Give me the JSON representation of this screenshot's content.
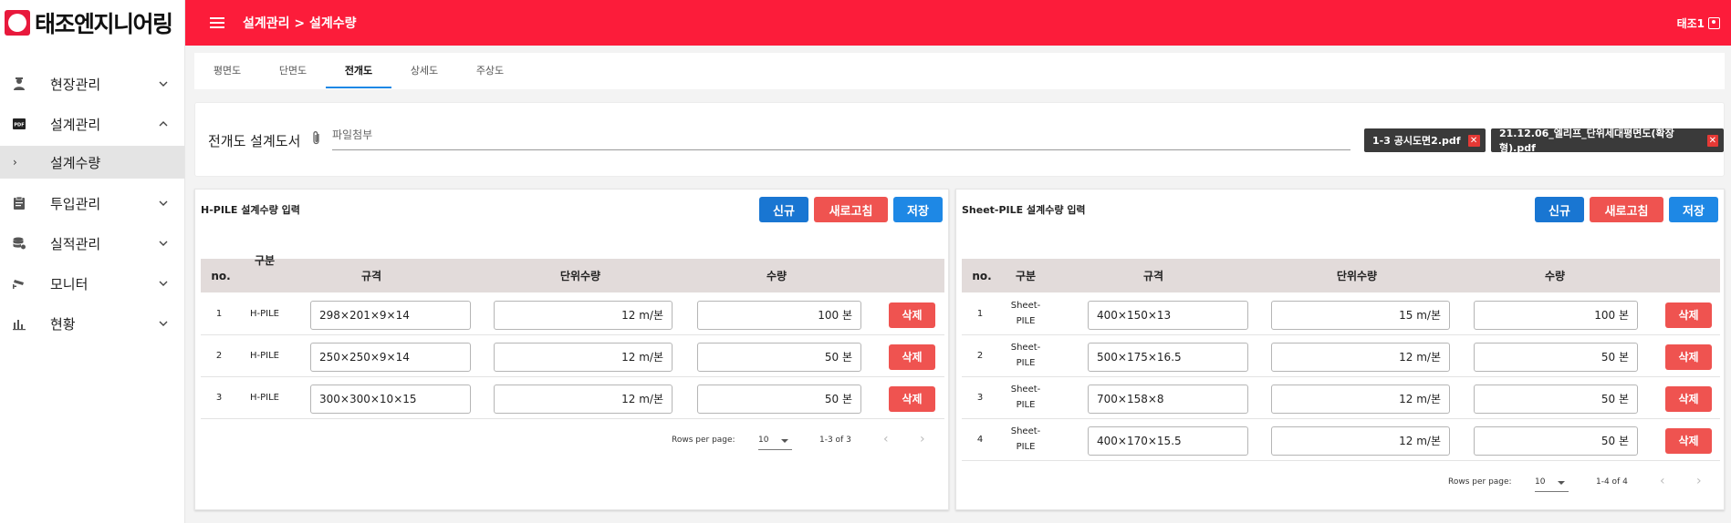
{
  "sidebar": {
    "logo_text": "태조엔지니어링",
    "items": [
      {
        "label": "현장관리",
        "icon": "worker-icon"
      },
      {
        "label": "설계관리",
        "icon": "pdf-icon"
      },
      {
        "label": "설계수량",
        "icon": "chevron-right-icon"
      },
      {
        "label": "투입관리",
        "icon": "clipboard-icon"
      },
      {
        "label": "실적관리",
        "icon": "database-icon"
      },
      {
        "label": "모니터",
        "icon": "cctv-icon"
      },
      {
        "label": "현황",
        "icon": "bar-chart-icon"
      }
    ]
  },
  "topbar": {
    "breadcrumb": "설계관리 > 설계수량",
    "user": "태조1",
    "accent": "#fc1c3a"
  },
  "tabs": [
    "평면도",
    "단면도",
    "전개도",
    "상세도",
    "주상도"
  ],
  "active_tab": "전개도",
  "files": {
    "title": "전개도 설계도서",
    "placeholder": "파일첨부",
    "chips": [
      "1-3 공시도면2.pdf",
      "21.12.06_엘리프_단위세대평면도(확장형).pdf"
    ]
  },
  "hpile": {
    "title": "H-PILE 설계수량 입력",
    "buttons": {
      "new": "신규",
      "refresh": "새로고침",
      "save": "저장"
    },
    "columns": [
      "no.",
      "구분",
      "규격",
      "단위수량",
      "수량"
    ],
    "rows": [
      {
        "no": "1",
        "type": "H-PILE",
        "spec": "298×201×9×14",
        "unit": "12 m/본",
        "qty": "100 본",
        "del": "삭제"
      },
      {
        "no": "2",
        "type": "H-PILE",
        "spec": "250×250×9×14",
        "unit": "12 m/본",
        "qty": "50 본",
        "del": "삭제"
      },
      {
        "no": "3",
        "type": "H-PILE",
        "spec": "300×300×10×15",
        "unit": "12 m/본",
        "qty": "50 본",
        "del": "삭제"
      }
    ],
    "pager": {
      "label": "Rows per page:",
      "per_page": "10",
      "range": "1-3 of 3"
    }
  },
  "sheetpile": {
    "title": "Sheet-PILE 설계수량 입력",
    "buttons": {
      "new": "신규",
      "refresh": "새로고침",
      "save": "저장"
    },
    "columns": [
      "no.",
      "구분",
      "규격",
      "단위수량",
      "수량"
    ],
    "rows": [
      {
        "no": "1",
        "type1": "Sheet-",
        "type2": "PILE",
        "spec": "400×150×13",
        "unit": "15 m/본",
        "qty": "100 본",
        "del": "삭제"
      },
      {
        "no": "2",
        "type1": "Sheet-",
        "type2": "PILE",
        "spec": "500×175×16.5",
        "unit": "12 m/본",
        "qty": "50 본",
        "del": "삭제"
      },
      {
        "no": "3",
        "type1": "Sheet-",
        "type2": "PILE",
        "spec": "700×158×8",
        "unit": "12 m/본",
        "qty": "50 본",
        "del": "삭제"
      },
      {
        "no": "4",
        "type1": "Sheet-",
        "type2": "PILE",
        "spec": "400×170×15.5",
        "unit": "12 m/본",
        "qty": "50 본",
        "del": "삭제"
      }
    ],
    "pager": {
      "label": "Rows per page:",
      "per_page": "10",
      "range": "1-4 of 4"
    }
  }
}
